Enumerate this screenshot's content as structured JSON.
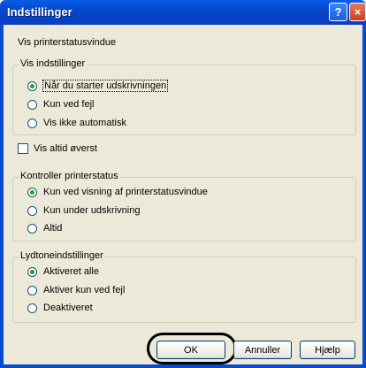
{
  "window": {
    "title": "Indstillinger",
    "help_glyph": "?",
    "close_glyph": "×"
  },
  "heading": "Vis printerstatusvindue",
  "group_display": {
    "legend": "Vis indstillinger",
    "options": [
      {
        "label": "Når du starter udskrivningen",
        "checked": true
      },
      {
        "label": "Kun ved fejl",
        "checked": false
      },
      {
        "label": "Vis ikke automatisk",
        "checked": false
      }
    ]
  },
  "always_on_top": {
    "label": "Vis altid øverst",
    "checked": false
  },
  "group_status": {
    "legend": "Kontroller printerstatus",
    "options": [
      {
        "label": "Kun ved visning af printerstatusvindue",
        "checked": true
      },
      {
        "label": "Kun under udskrivning",
        "checked": false
      },
      {
        "label": "Altid",
        "checked": false
      }
    ]
  },
  "group_sound": {
    "legend": "Lydtoneindstillinger",
    "options": [
      {
        "label": "Aktiveret alle",
        "checked": true
      },
      {
        "label": "Aktiver kun ved fejl",
        "checked": false
      },
      {
        "label": "Deaktiveret",
        "checked": false
      }
    ]
  },
  "buttons": {
    "ok": "OK",
    "cancel": "Annuller",
    "help": "Hjælp"
  }
}
